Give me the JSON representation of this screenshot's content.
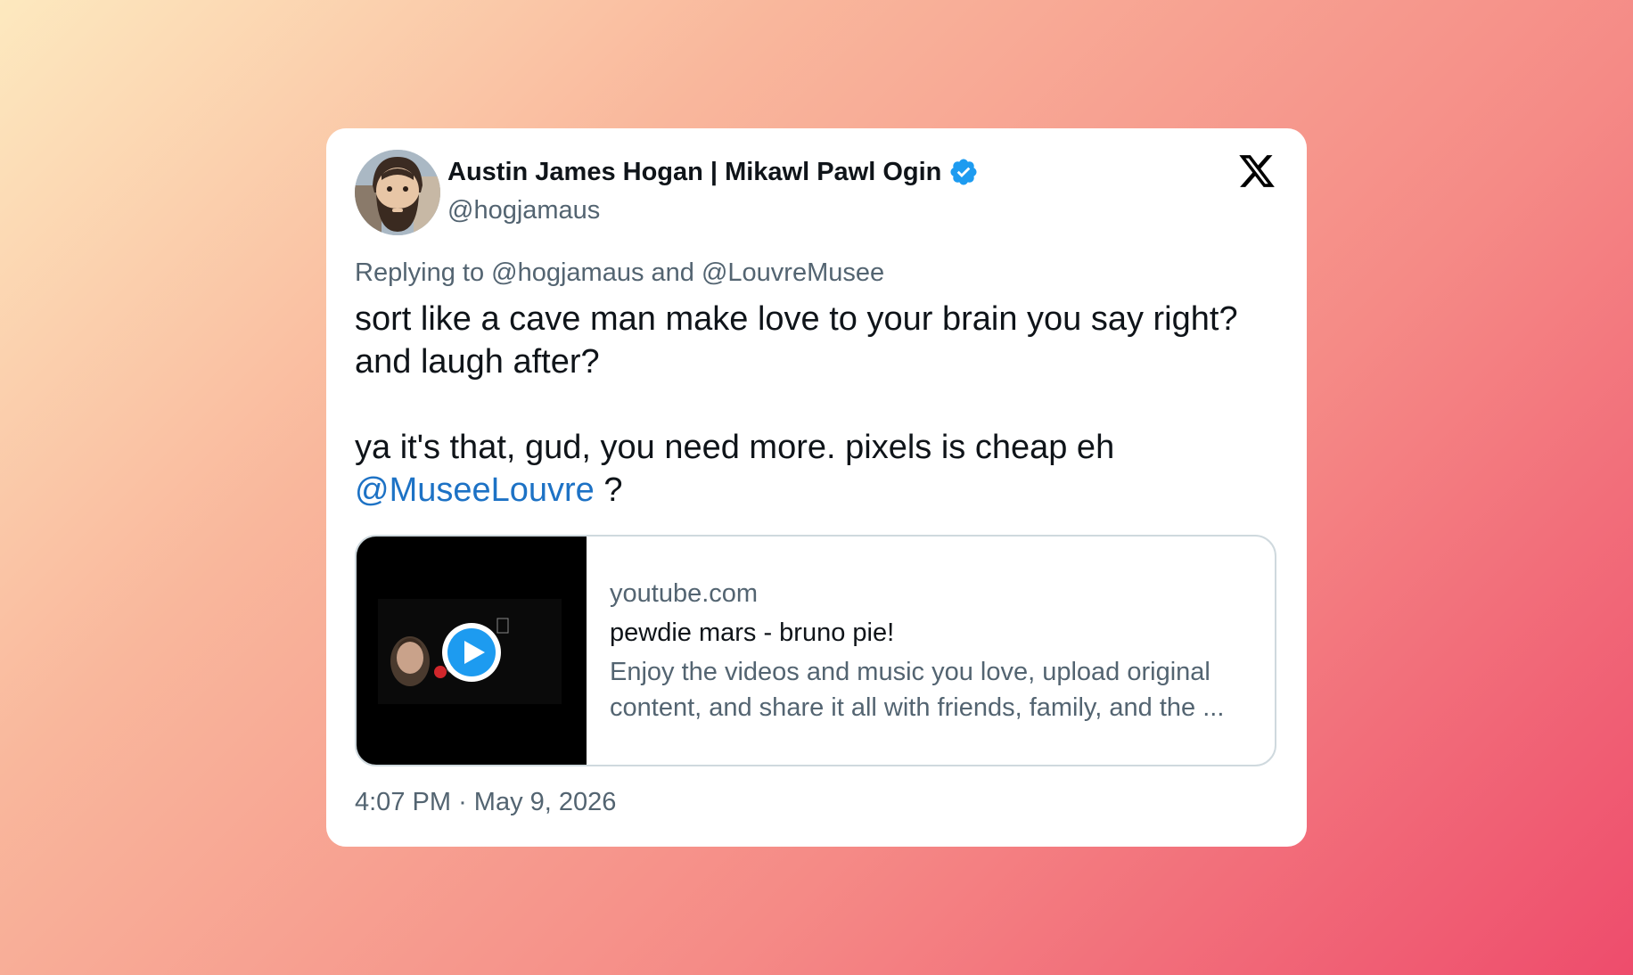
{
  "user": {
    "display_name": "Austin James Hogan | Mikawl Pawl Ogin",
    "handle": "@hogjamaus",
    "verified": true,
    "avatar_icon": "bearded-man-avatar"
  },
  "platform_icon": "x-logo-icon",
  "reply": {
    "prefix": "Replying to",
    "user1": "@hogjamaus",
    "conjunction": "and",
    "user2": "@LouvreMusee"
  },
  "tweet": {
    "line1": "sort like a cave man make love to your brain you say right? and laugh after?",
    "line2": "ya it's that, gud, you need more. pixels is cheap eh",
    "mention": "@MuseeLouvre",
    "trailing": " ?"
  },
  "link_card": {
    "domain": "youtube.com",
    "title": "pewdie mars - bruno pie!",
    "description": "Enjoy the videos and music you love, upload original content, and share it all with friends, family, and the ...",
    "thumbnail_icon": "play-button-icon"
  },
  "meta": {
    "time": "4:07 PM",
    "separator": "·",
    "date": "May 9, 2026"
  },
  "colors": {
    "mention": "#1d72c5",
    "verified": "#1d9bf0",
    "secondary_text": "#536471",
    "primary_text": "#0f1419"
  }
}
